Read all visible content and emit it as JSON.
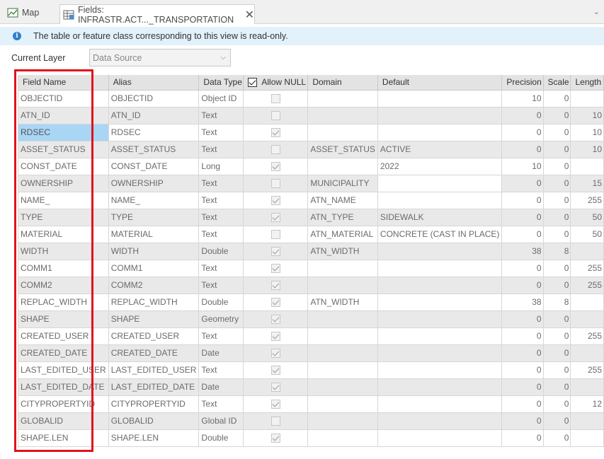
{
  "tabs": [
    {
      "label": "Map",
      "icon": "map-icon"
    },
    {
      "label": "Fields: INFRASTR.ACT..._TRANSPORTATION",
      "icon": "fields-table-icon"
    }
  ],
  "banner": {
    "text": "The table or feature class corresponding to this view is read-only."
  },
  "current_layer": {
    "label": "Current Layer",
    "value": "Data Source"
  },
  "columns": [
    "Field Name",
    "Alias",
    "Data Type",
    "Allow NULL",
    "Domain",
    "Default",
    "Precision",
    "Scale",
    "Length"
  ],
  "rows": [
    {
      "field": "OBJECTID",
      "alias": "OBJECTID",
      "type": "Object ID",
      "null": false,
      "domain": "",
      "default": "",
      "precision": "10",
      "scale": "0",
      "length": ""
    },
    {
      "field": "ATN_ID",
      "alias": "ATN_ID",
      "type": "Text",
      "null": false,
      "domain": "",
      "default": "",
      "precision": "0",
      "scale": "0",
      "length": "10"
    },
    {
      "field": "RDSEC",
      "alias": "RDSEC",
      "type": "Text",
      "null": true,
      "domain": "",
      "default": "",
      "precision": "0",
      "scale": "0",
      "length": "10"
    },
    {
      "field": "ASSET_STATUS",
      "alias": "ASSET_STATUS",
      "type": "Text",
      "null": false,
      "domain": "ASSET_STATUS",
      "default": "ACTIVE",
      "precision": "0",
      "scale": "0",
      "length": "10"
    },
    {
      "field": "CONST_DATE",
      "alias": "CONST_DATE",
      "type": "Long",
      "null": true,
      "domain": "",
      "default": "2022",
      "precision": "10",
      "scale": "0",
      "length": ""
    },
    {
      "field": "OWNERSHIP",
      "alias": "OWNERSHIP",
      "type": "Text",
      "null": false,
      "domain": "MUNICIPALITY",
      "default": "",
      "precision": "0",
      "scale": "0",
      "length": "15"
    },
    {
      "field": "NAME_",
      "alias": "NAME_",
      "type": "Text",
      "null": true,
      "domain": "ATN_NAME",
      "default": "",
      "precision": "0",
      "scale": "0",
      "length": "255"
    },
    {
      "field": "TYPE",
      "alias": "TYPE",
      "type": "Text",
      "null": true,
      "domain": "ATN_TYPE",
      "default": "SIDEWALK",
      "precision": "0",
      "scale": "0",
      "length": "50"
    },
    {
      "field": "MATERIAL",
      "alias": "MATERIAL",
      "type": "Text",
      "null": false,
      "domain": "ATN_MATERIAL",
      "default": "CONCRETE (CAST IN PLACE)",
      "precision": "0",
      "scale": "0",
      "length": "50"
    },
    {
      "field": "WIDTH",
      "alias": "WIDTH",
      "type": "Double",
      "null": true,
      "domain": "ATN_WIDTH",
      "default": "",
      "precision": "38",
      "scale": "8",
      "length": ""
    },
    {
      "field": "COMM1",
      "alias": "COMM1",
      "type": "Text",
      "null": true,
      "domain": "",
      "default": "",
      "precision": "0",
      "scale": "0",
      "length": "255"
    },
    {
      "field": "COMM2",
      "alias": "COMM2",
      "type": "Text",
      "null": true,
      "domain": "",
      "default": "",
      "precision": "0",
      "scale": "0",
      "length": "255"
    },
    {
      "field": "REPLAC_WIDTH",
      "alias": "REPLAC_WIDTH",
      "type": "Double",
      "null": true,
      "domain": "ATN_WIDTH",
      "default": "",
      "precision": "38",
      "scale": "8",
      "length": ""
    },
    {
      "field": "SHAPE",
      "alias": "SHAPE",
      "type": "Geometry",
      "null": true,
      "domain": "",
      "default": "",
      "precision": "0",
      "scale": "0",
      "length": ""
    },
    {
      "field": "CREATED_USER",
      "alias": "CREATED_USER",
      "type": "Text",
      "null": true,
      "domain": "",
      "default": "",
      "precision": "0",
      "scale": "0",
      "length": "255"
    },
    {
      "field": "CREATED_DATE",
      "alias": "CREATED_DATE",
      "type": "Date",
      "null": true,
      "domain": "",
      "default": "",
      "precision": "0",
      "scale": "0",
      "length": ""
    },
    {
      "field": "LAST_EDITED_USER",
      "alias": "LAST_EDITED_USER",
      "type": "Text",
      "null": true,
      "domain": "",
      "default": "",
      "precision": "0",
      "scale": "0",
      "length": "255"
    },
    {
      "field": "LAST_EDITED_DATE",
      "alias": "LAST_EDITED_DATE",
      "type": "Date",
      "null": true,
      "domain": "",
      "default": "",
      "precision": "0",
      "scale": "0",
      "length": ""
    },
    {
      "field": "CITYPROPERTYID",
      "alias": "CITYPROPERTYID",
      "type": "Text",
      "null": true,
      "domain": "",
      "default": "",
      "precision": "0",
      "scale": "0",
      "length": "12"
    },
    {
      "field": "GLOBALID",
      "alias": "GLOBALID",
      "type": "Global ID",
      "null": false,
      "domain": "",
      "default": "",
      "precision": "0",
      "scale": "0",
      "length": ""
    },
    {
      "field": "SHAPE.LEN",
      "alias": "SHAPE.LEN",
      "type": "Double",
      "null": true,
      "domain": "",
      "default": "",
      "precision": "0",
      "scale": "0",
      "length": ""
    }
  ],
  "selected_row": 2,
  "colors": {
    "accent": "#2f7fd0",
    "highlight": "#e0121b",
    "selection": "#a9d6f5",
    "banner": "#e3f1fb"
  }
}
